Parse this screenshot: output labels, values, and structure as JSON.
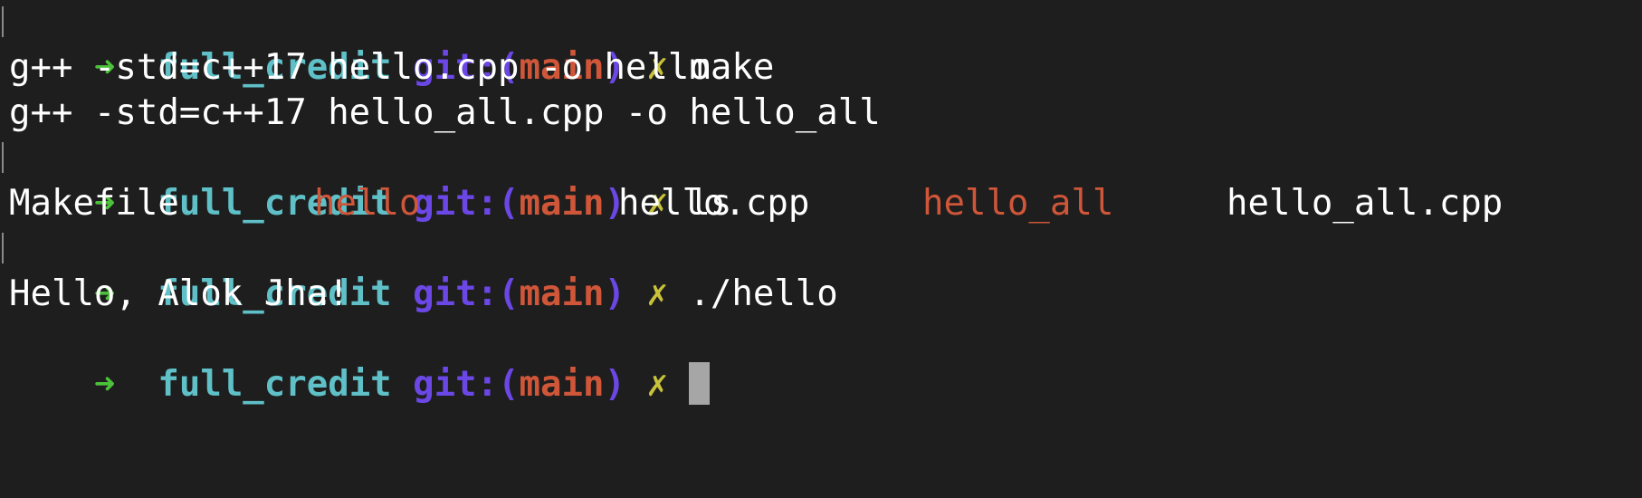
{
  "prompt": {
    "arrow": "➜",
    "directory": "full_credit",
    "git_prefix": "git:(",
    "branch": "main",
    "git_suffix": ")",
    "dirty_marker": "✗"
  },
  "session": [
    {
      "type": "prompt",
      "command": "make"
    },
    {
      "type": "output",
      "text": "g++ -std=c++17 hello.cpp -o hello"
    },
    {
      "type": "output",
      "text": "g++ -std=c++17 hello_all.cpp -o hello_all"
    },
    {
      "type": "prompt",
      "command": "ls"
    },
    {
      "type": "listing",
      "items": [
        {
          "name": "Makefile",
          "executable": false
        },
        {
          "name": "hello",
          "executable": true
        },
        {
          "name": "hello.cpp",
          "executable": false
        },
        {
          "name": "hello_all",
          "executable": true
        },
        {
          "name": "hello_all.cpp",
          "executable": false
        }
      ]
    },
    {
      "type": "prompt",
      "command": "./hello"
    },
    {
      "type": "output",
      "text": "Hello, Alok Jha!"
    },
    {
      "type": "prompt",
      "command": ""
    }
  ],
  "colors": {
    "background": "#1e1e1e",
    "foreground": "#ffffff",
    "arrow": "#4cc23a",
    "directory": "#5fc0c8",
    "git": "#6b47e6",
    "branch": "#cf5639",
    "dirty": "#c8c23a",
    "executable": "#cf5639",
    "cursor": "#a6a6a6"
  }
}
